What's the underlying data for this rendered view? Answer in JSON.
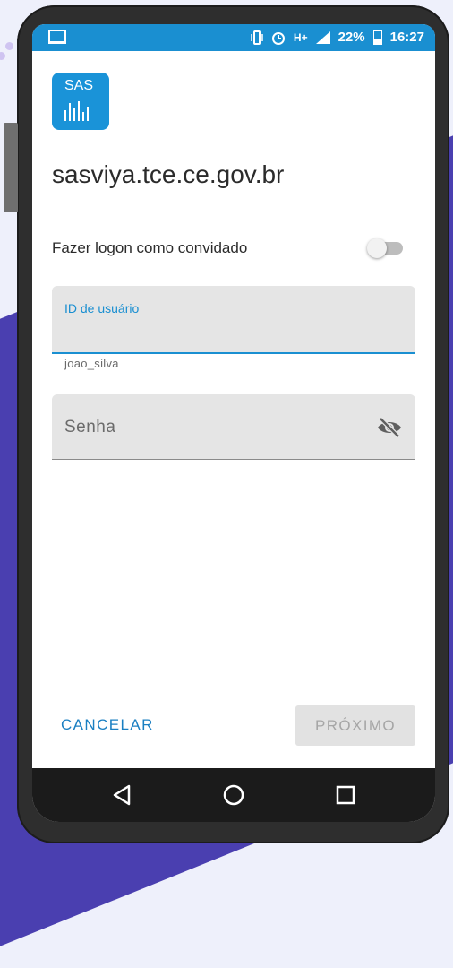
{
  "status_bar": {
    "indicators": "H+",
    "battery": "22%",
    "time": "16:27"
  },
  "logo": {
    "text": "SAS"
  },
  "server": {
    "title": "sasviya.tce.ce.gov.br"
  },
  "guest": {
    "label": "Fazer logon como convidado",
    "enabled": false
  },
  "user_field": {
    "label": "ID de usuário",
    "value": "",
    "helper": "joao_silva"
  },
  "password_field": {
    "placeholder": "Senha",
    "icon": "eye-off-icon"
  },
  "buttons": {
    "cancel": "CANCELAR",
    "next": "PRÓXIMO"
  },
  "colors": {
    "accent": "#1a8fd1",
    "logo_bg": "#1a93d8",
    "field_bg": "#e5e5e5",
    "disabled_text": "#a6a6a6"
  },
  "nav_bar": {
    "icons": [
      "back-icon",
      "home-icon",
      "recents-icon"
    ]
  }
}
